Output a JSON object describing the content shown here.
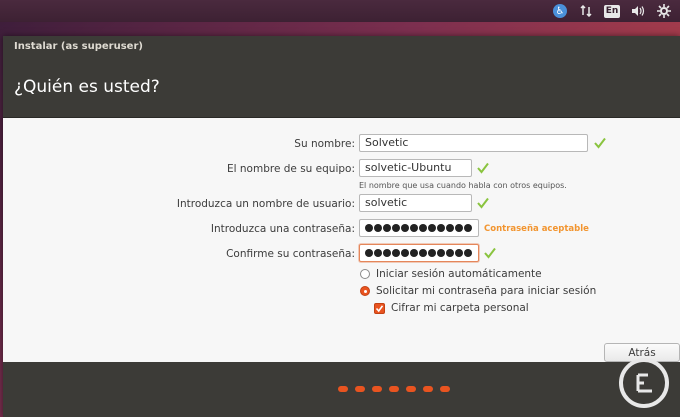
{
  "top_panel": {
    "keyboard_layout": "En",
    "icons": [
      "accessibility-icon",
      "network-icon",
      "keyboard-layout-icon",
      "volume-icon",
      "settings-icon"
    ]
  },
  "window": {
    "title": "Instalar (as superuser)",
    "heading": "¿Quién es usted?"
  },
  "form": {
    "name_label": "Su nombre:",
    "name_value": "Solvetic",
    "computer_label": "El nombre de su equipo:",
    "computer_value": "solvetic-Ubuntu",
    "computer_hint": "El nombre que usa cuando habla con otros equipos.",
    "username_label": "Introduzca un nombre de usuario:",
    "username_value": "solvetic",
    "password_label": "Introduzca una contraseña:",
    "password_length": 12,
    "password_strength": "Contraseña aceptable",
    "confirm_label": "Confirme su contraseña:",
    "confirm_length": 12
  },
  "options": {
    "auto_login_label": "Iniciar sesión automáticamente",
    "auto_login_selected": false,
    "require_password_label": "Solicitar mi contraseña para iniciar sesión",
    "require_password_selected": true,
    "encrypt_home_label": "Cifrar mi carpeta personal",
    "encrypt_home_checked": true
  },
  "buttons": {
    "back_label": "Atrás"
  },
  "progress": {
    "steps_shown": 7
  },
  "colors": {
    "accent": "#e95420",
    "check_green": "#8ac43f",
    "strength_orange": "#f29530",
    "dark_chrome": "#3c3b37"
  }
}
